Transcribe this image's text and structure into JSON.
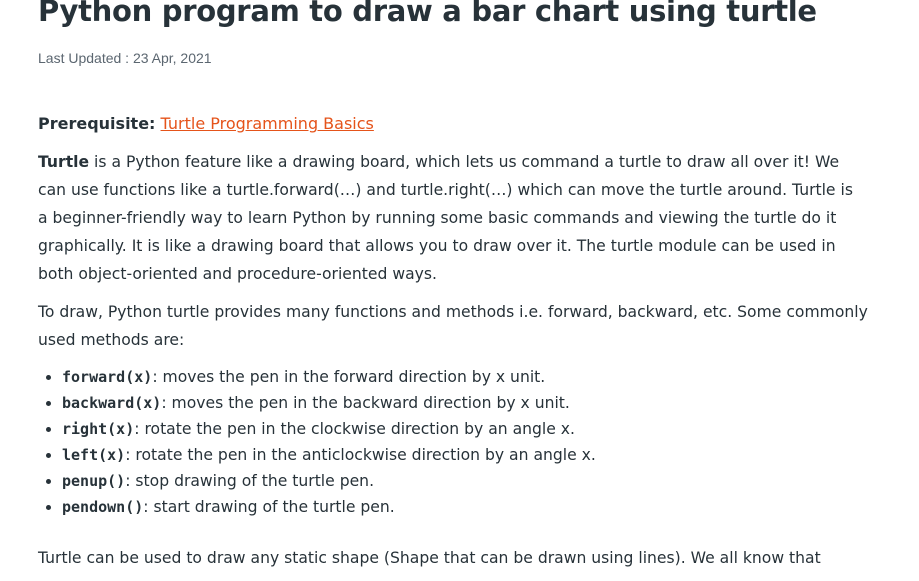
{
  "article": {
    "title": "Python program to draw a bar chart using turtle",
    "last_updated": "Last Updated : 23 Apr, 2021",
    "prerequisite_label": "Prerequisite:",
    "prerequisite_link": "Turtle Programming Basics",
    "intro_bold": "Turtle",
    "intro_rest": " is a Python feature like a drawing board, which lets us command a turtle to draw all over it! We can use functions like a turtle.forward(…) and turtle.right(…) which can move the turtle around. Turtle is a beginner-friendly way to learn Python by running some basic commands and viewing the turtle do it graphically. It is like a drawing board that allows you to draw over it. The turtle module can be used in both object-oriented and procedure-oriented ways.",
    "methods_intro": "To draw, Python turtle provides many functions and methods i.e. forward, backward, etc. Some commonly used methods are:",
    "methods": [
      {
        "name": "forward(x)",
        "desc": ": moves the pen in the forward direction by x unit."
      },
      {
        "name": "backward(x)",
        "desc": ": moves the pen in the backward direction by x unit."
      },
      {
        "name": "right(x)",
        "desc": ": rotate the pen in the clockwise direction by an angle x."
      },
      {
        "name": "left(x)",
        "desc": ": rotate the pen in the anticlockwise direction by an angle x."
      },
      {
        "name": "penup()",
        "desc": ": stop drawing of the turtle pen."
      },
      {
        "name": "pendown()",
        "desc": ": start drawing of the turtle pen."
      }
    ],
    "closing": "Turtle can be used to draw any static shape (Shape that can be drawn using lines). We all know that"
  },
  "colors": {
    "text": "#273239",
    "muted": "#5b6670",
    "link": "#e5531a"
  }
}
